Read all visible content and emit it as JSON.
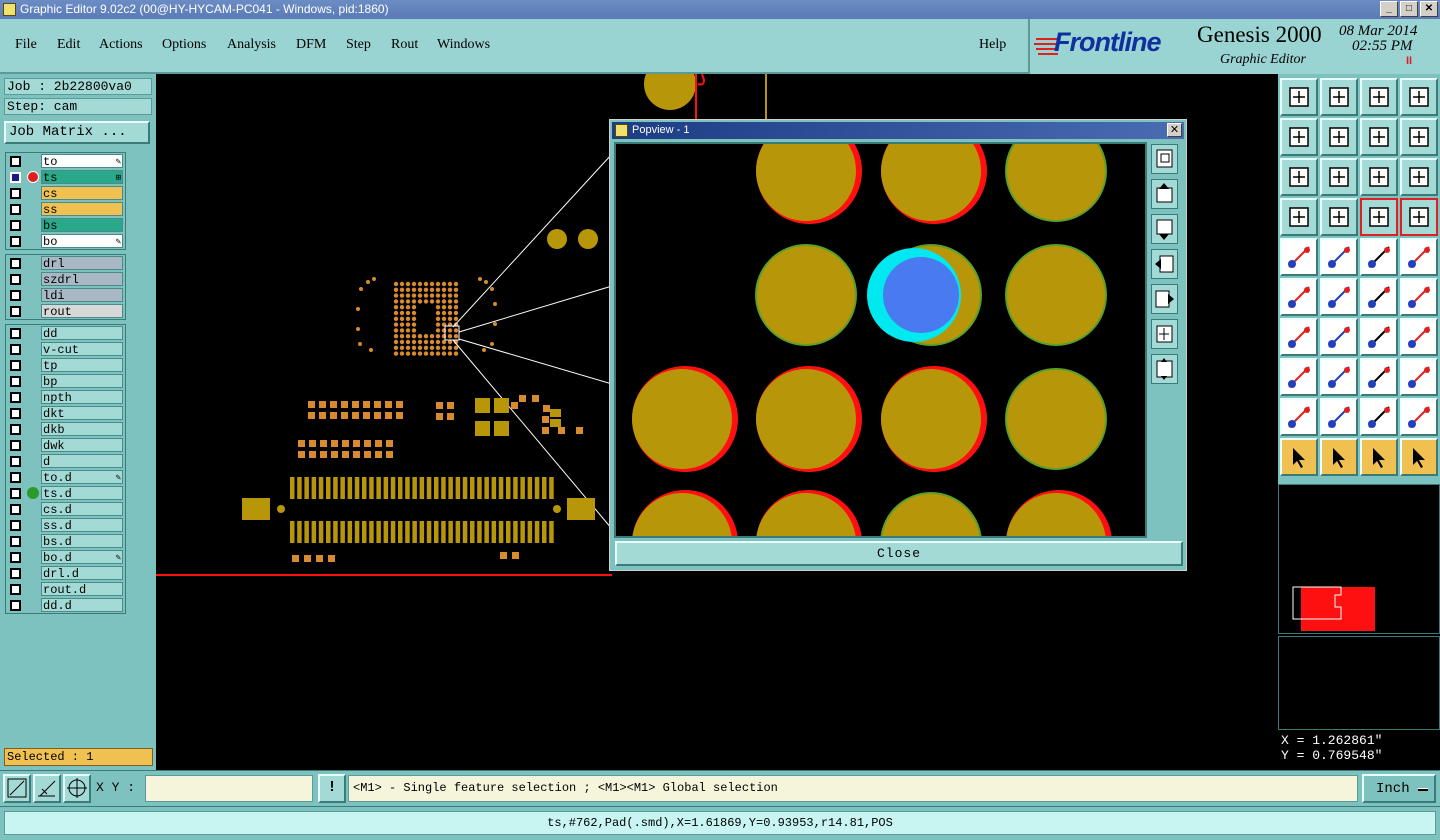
{
  "window": {
    "title": "Graphic Editor 9.02c2 (00@HY-HYCAM-PC041 - Windows, pid:1860)",
    "btn_min": "_",
    "btn_max": "□",
    "btn_close": "✕"
  },
  "menu": {
    "items": [
      "File",
      "Edit",
      "Actions",
      "Options",
      "Analysis",
      "DFM",
      "Step",
      "Rout",
      "Windows"
    ],
    "help": "Help"
  },
  "brand": {
    "logo": "Frontline",
    "product": "Genesis 2000",
    "subtitle": "Graphic Editor",
    "date": "08 Mar 2014",
    "time": "02:55 PM",
    "pause": "II"
  },
  "job": {
    "job_line": "Job : 2b22800va0",
    "step_line": "Step: cam",
    "matrix_button": "Job Matrix ..."
  },
  "layers": {
    "group1": [
      {
        "name": "to",
        "color": "#ffffff",
        "mark": "✎"
      },
      {
        "name": "ts",
        "color": "#2aa88a",
        "mark": "⊞",
        "active": true
      },
      {
        "name": "cs",
        "color": "#f0c050"
      },
      {
        "name": "ss",
        "color": "#f0c050"
      },
      {
        "name": "bs",
        "color": "#2aa88a"
      },
      {
        "name": "bo",
        "color": "#ffffff",
        "mark": "✎"
      }
    ],
    "group2": [
      {
        "name": "drl",
        "color": "#a8b8c4"
      },
      {
        "name": "szdrl",
        "color": "#a8b8c4"
      },
      {
        "name": "ldi",
        "color": "#a8b8c4"
      },
      {
        "name": "rout",
        "color": "#d8d8d8"
      }
    ],
    "group3": [
      {
        "name": "dd",
        "color": "#a4dad6"
      },
      {
        "name": "v-cut",
        "color": "#a4dad6"
      },
      {
        "name": "tp",
        "color": "#a4dad6"
      },
      {
        "name": "bp",
        "color": "#a4dad6"
      },
      {
        "name": "npth",
        "color": "#a4dad6"
      },
      {
        "name": "dkt",
        "color": "#a4dad6"
      },
      {
        "name": "dkb",
        "color": "#a4dad6"
      },
      {
        "name": "dwk",
        "color": "#a4dad6"
      },
      {
        "name": "d",
        "color": "#a4dad6"
      },
      {
        "name": "to.d",
        "color": "#a4dad6",
        "mark": "✎"
      },
      {
        "name": "ts.d",
        "color": "#a4dad6",
        "dot": true
      },
      {
        "name": "cs.d",
        "color": "#a4dad6"
      },
      {
        "name": "ss.d",
        "color": "#a4dad6"
      },
      {
        "name": "bs.d",
        "color": "#a4dad6"
      },
      {
        "name": "bo.d",
        "color": "#a4dad6",
        "mark": "✎"
      },
      {
        "name": "drl.d",
        "color": "#a4dad6"
      },
      {
        "name": "rout.d",
        "color": "#a4dad6"
      },
      {
        "name": "dd.d",
        "color": "#a4dad6"
      }
    ]
  },
  "selected": "Selected : 1",
  "popview": {
    "title": "Popview - 1",
    "close_x": "✕",
    "close_button": "Close"
  },
  "coords": {
    "x": "X = 1.262861\"",
    "y": "Y = 0.769548\""
  },
  "bottom": {
    "xy_label": "X Y :",
    "xy_value": "",
    "excl": "!",
    "hint": "<M1> - Single feature selection ; <M1><M1> Global selection",
    "units": "Inch"
  },
  "status": "ts,#762,Pad(.smd),X=1.61869,Y=0.93953,r14.81,POS",
  "colors": {
    "panel": "#7ec2bf",
    "panel_light": "#a4dad6",
    "pad": "#b8960a",
    "pad_red": "#ff1010",
    "pad_green": "#5aa02a",
    "highlight": "#4a7af0",
    "highlight_cyan": "#00e8f0"
  }
}
